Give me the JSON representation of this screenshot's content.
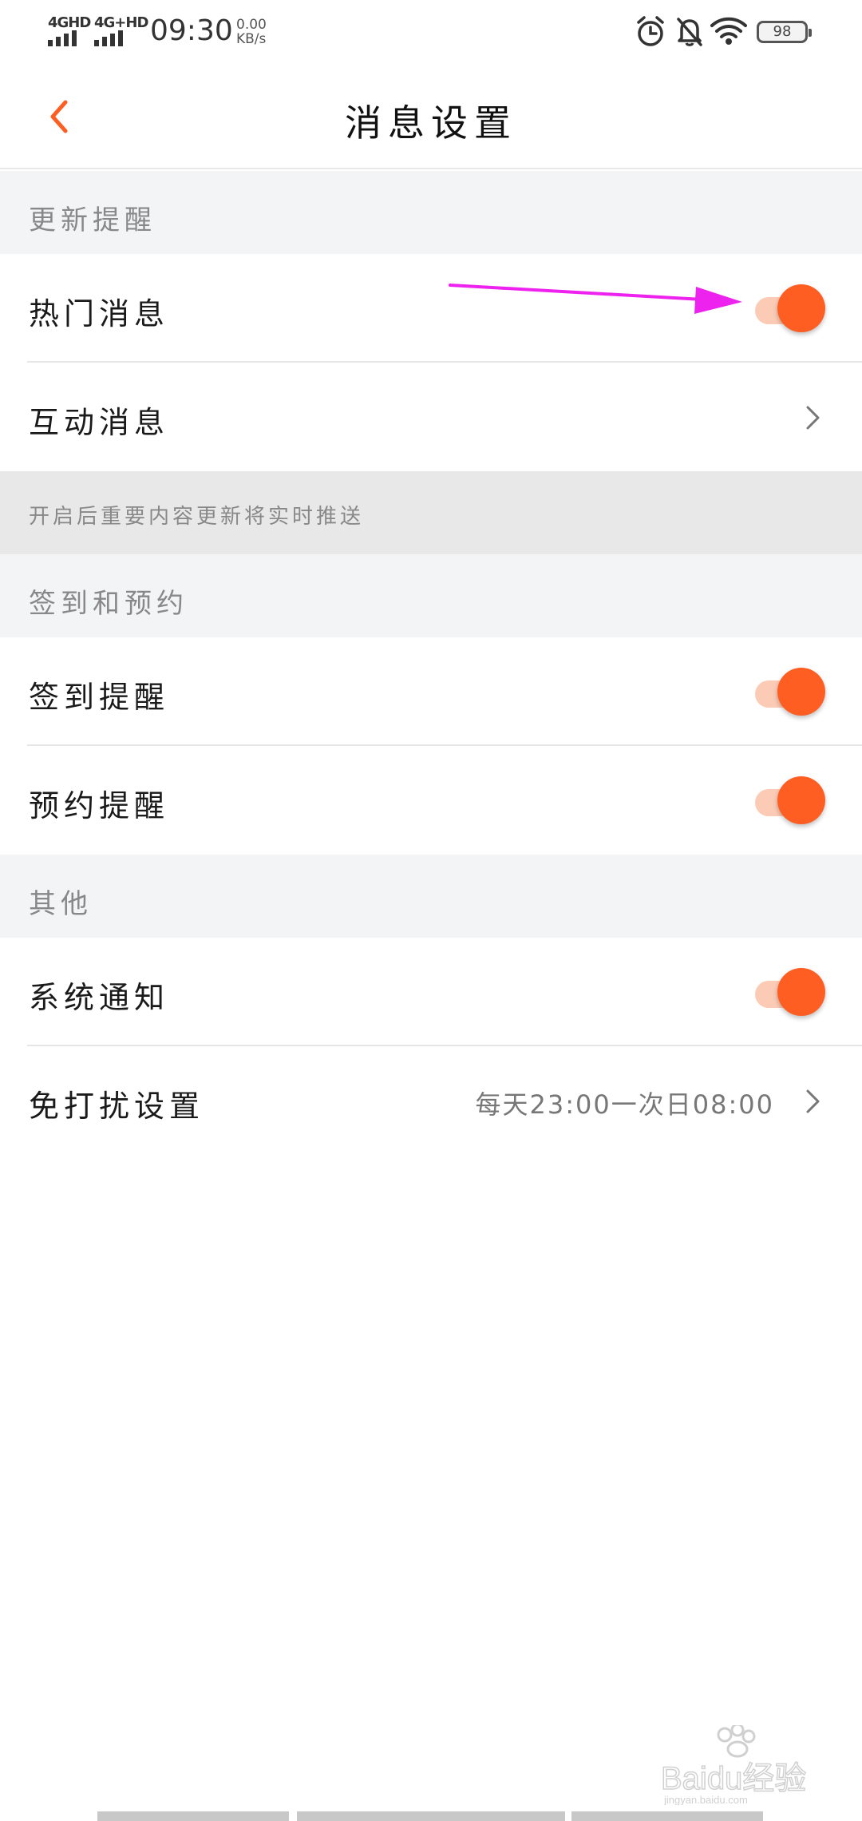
{
  "status_bar": {
    "net1": "4GHD",
    "net2": "4G+HD",
    "time": "09:30",
    "speed_value": "0.00",
    "speed_unit": "KB/s",
    "battery": "98",
    "icons": [
      "alarm-icon",
      "mute-bell-icon",
      "wifi-icon",
      "battery-icon"
    ]
  },
  "header": {
    "title": "消息设置",
    "back_icon": "chevron-left-icon"
  },
  "sections": {
    "update": {
      "title": "更新提醒"
    },
    "update_note": "开启后重要内容更新将实时推送",
    "checkin": {
      "title": "签到和预约"
    },
    "other": {
      "title": "其他"
    }
  },
  "rows": {
    "hot_messages": {
      "label": "热门消息",
      "enabled": true
    },
    "interactive_messages": {
      "label": "互动消息"
    },
    "checkin_reminder": {
      "label": "签到提醒",
      "enabled": true
    },
    "reservation_reminder": {
      "label": "预约提醒",
      "enabled": true
    },
    "system_notice": {
      "label": "系统通知",
      "enabled": true
    },
    "dnd": {
      "label": "免打扰设置",
      "value": "每天23:00一次日08:00"
    }
  },
  "watermark": {
    "text": "Baidu经验",
    "sub": "jingyan.baidu.com"
  },
  "colors": {
    "accent": "#ff5e22",
    "track": "#fbcbb5",
    "annotation": "#ee22ee"
  }
}
